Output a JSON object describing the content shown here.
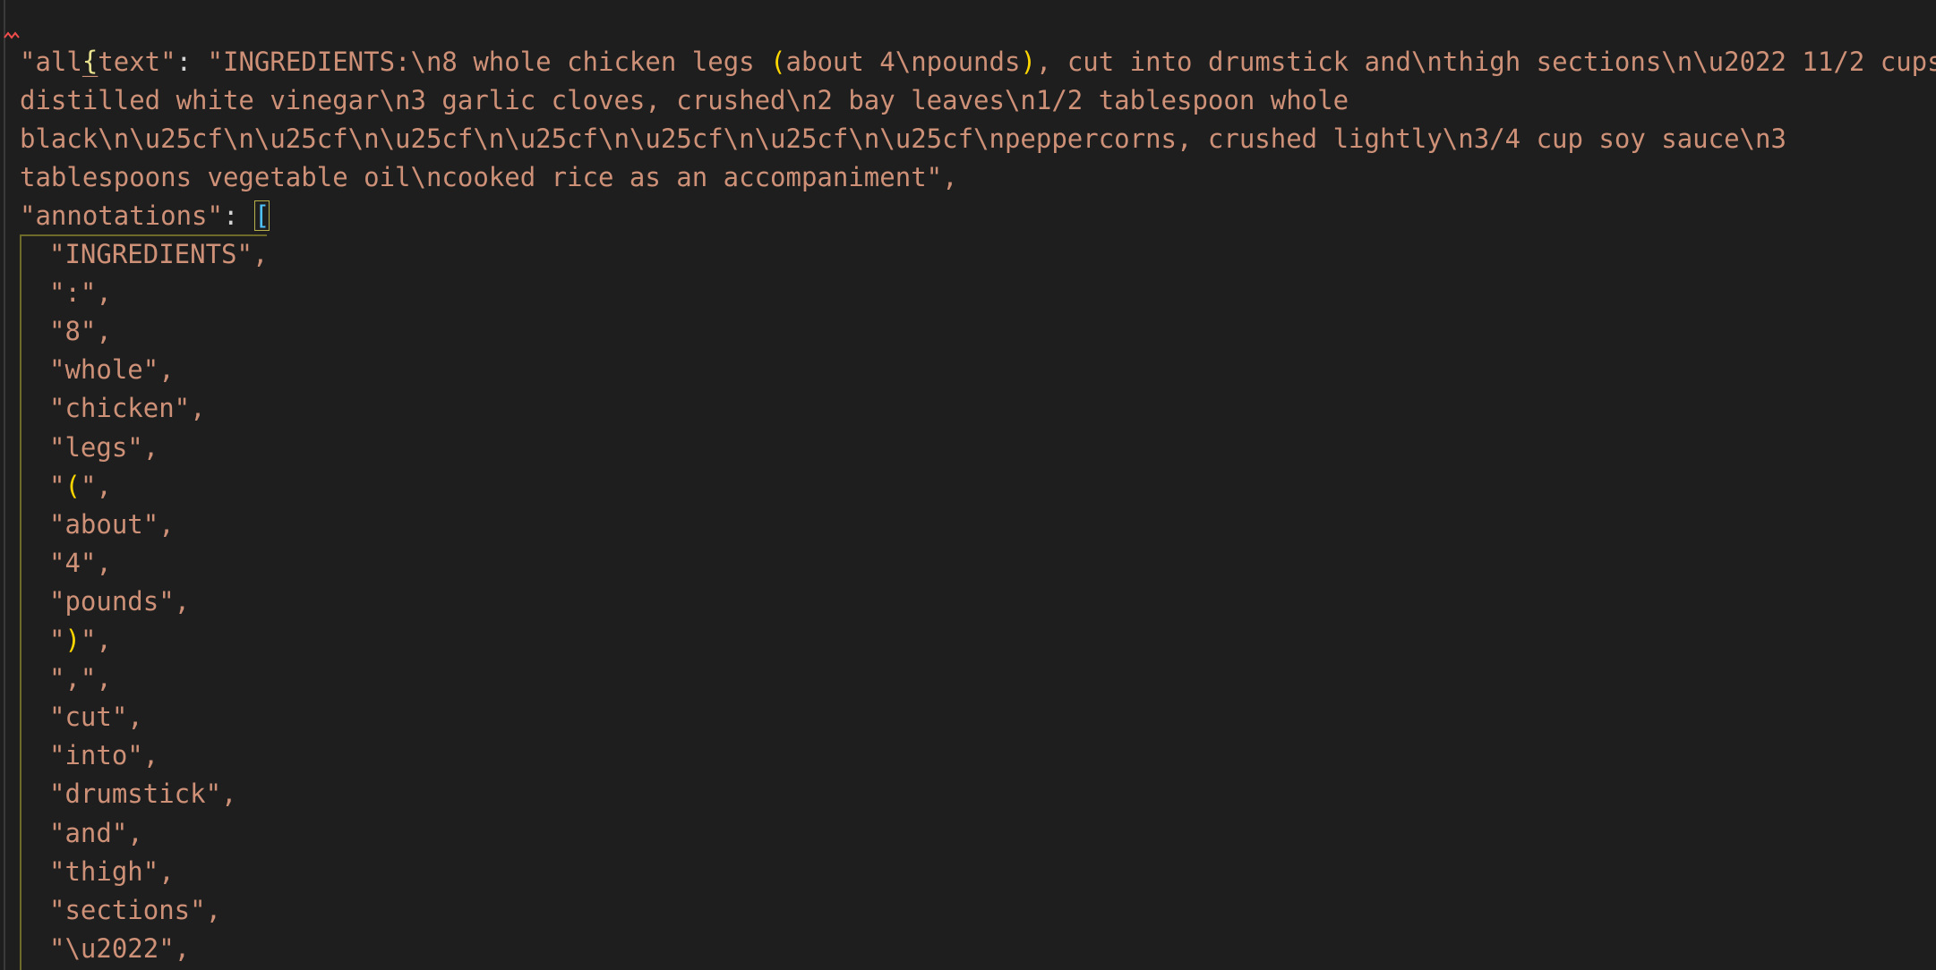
{
  "editor": {
    "open_brace": "{",
    "all_text_key": "\"all_text\"",
    "all_text_lines": [
      "\"INGREDIENTS:\\n8 whole chicken legs ",
      "distilled white vinegar\\n3 garlic cloves, crushed\\n2 bay leaves\\n1/2 tablespoon whole",
      "black\\n\\u25cf\\n\\u25cf\\n\\u25cf\\n\\u25cf\\n\\u25cf\\n\\u25cf\\n\\u25cf\\npeppercorns, crushed lightly\\n3/4 cup soy sauce\\n3",
      "tablespoons vegetable oil\\ncooked rice as an accompaniment\","
    ],
    "line1_paren_open": "(",
    "line1_paren_inner": "about 4\\npounds",
    "line1_paren_close": ")",
    "line1_tail": ", cut into drumstick and\\nthigh sections\\n\\u2022 11/2 cups",
    "annotations_key": "\"annotations\"",
    "annotations_open": "[",
    "annotations": [
      "\"INGREDIENTS\",",
      "\":\",",
      "\"8\",",
      "\"whole\",",
      "\"chicken\",",
      "\"legs\",",
      "\"(\",",
      "\"about\",",
      "\"4\",",
      "\"pounds\",",
      "\")\",",
      "\",\",",
      "\"cut\",",
      "\"into\",",
      "\"drumstick\",",
      "\"and\",",
      "\"thigh\",",
      "\"sections\",",
      "\"\\u2022\","
    ]
  },
  "colors": {
    "background": "#1e1e1e",
    "string": "#ce9178",
    "brace": "#e8e28f",
    "paren": "#ffd700",
    "bracket": "#4fc1ff"
  }
}
